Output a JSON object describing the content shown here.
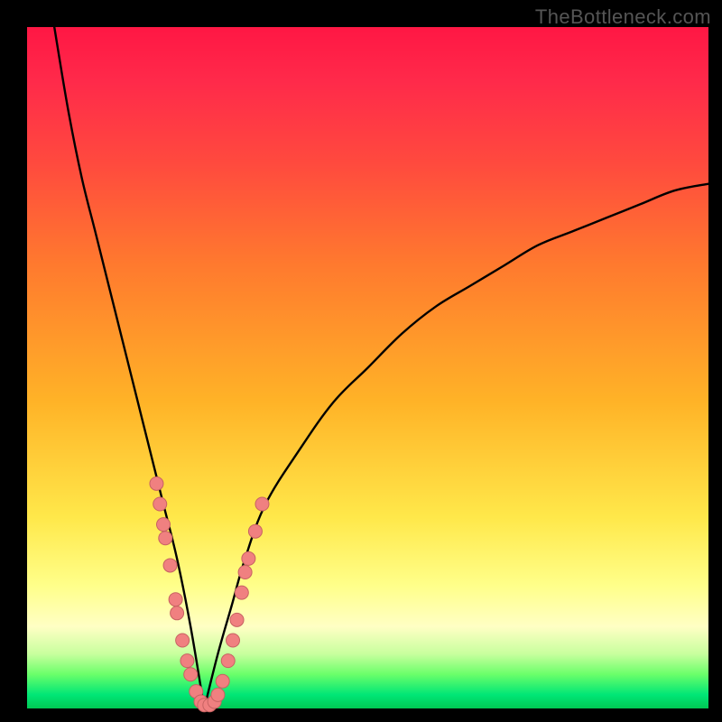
{
  "watermark": "TheBottleneck.com",
  "colors": {
    "frame": "#000000",
    "curve": "#000000",
    "marker_fill": "#f08080",
    "marker_stroke": "#c76262",
    "gradient_top": "#ff1744",
    "gradient_bottom": "#00c853"
  },
  "chart_data": {
    "type": "line",
    "title": "",
    "xlabel": "",
    "ylabel": "",
    "xlim": [
      0,
      100
    ],
    "ylim": [
      0,
      100
    ],
    "grid": false,
    "legend": false,
    "note": "V-shaped bottleneck curve. x is normalized component ratio 0–100, y is bottleneck % 0–100. Minimum (0% bottleneck) occurs near x≈26. Left branch rises steeply to 100% at x≈4; right branch rises with diminishing slope reaching ≈77% at x=100.",
    "series": [
      {
        "name": "bottleneck-curve-left",
        "x": [
          4,
          6,
          8,
          10,
          12,
          14,
          16,
          18,
          20,
          22,
          24,
          26
        ],
        "y": [
          100,
          88,
          78,
          70,
          62,
          54,
          46,
          38,
          30,
          22,
          12,
          0
        ]
      },
      {
        "name": "bottleneck-curve-right",
        "x": [
          26,
          28,
          30,
          32,
          35,
          40,
          45,
          50,
          55,
          60,
          65,
          70,
          75,
          80,
          85,
          90,
          95,
          100
        ],
        "y": [
          0,
          8,
          15,
          22,
          30,
          38,
          45,
          50,
          55,
          59,
          62,
          65,
          68,
          70,
          72,
          74,
          76,
          77
        ]
      }
    ],
    "markers": {
      "name": "sample-points",
      "note": "salmon bead markers clustered near the trough of the V",
      "points": [
        {
          "x": 19.0,
          "y": 33
        },
        {
          "x": 19.5,
          "y": 30
        },
        {
          "x": 20.0,
          "y": 27
        },
        {
          "x": 20.3,
          "y": 25
        },
        {
          "x": 21.0,
          "y": 21
        },
        {
          "x": 21.8,
          "y": 16
        },
        {
          "x": 22.0,
          "y": 14
        },
        {
          "x": 22.8,
          "y": 10
        },
        {
          "x": 23.5,
          "y": 7
        },
        {
          "x": 24.0,
          "y": 5
        },
        {
          "x": 24.8,
          "y": 2.5
        },
        {
          "x": 25.5,
          "y": 1
        },
        {
          "x": 26.0,
          "y": 0.5
        },
        {
          "x": 26.8,
          "y": 0.5
        },
        {
          "x": 27.5,
          "y": 1
        },
        {
          "x": 28.0,
          "y": 2
        },
        {
          "x": 28.7,
          "y": 4
        },
        {
          "x": 29.5,
          "y": 7
        },
        {
          "x": 30.2,
          "y": 10
        },
        {
          "x": 30.8,
          "y": 13
        },
        {
          "x": 31.5,
          "y": 17
        },
        {
          "x": 32.0,
          "y": 20
        },
        {
          "x": 32.5,
          "y": 22
        },
        {
          "x": 33.5,
          "y": 26
        },
        {
          "x": 34.5,
          "y": 30
        }
      ]
    }
  }
}
